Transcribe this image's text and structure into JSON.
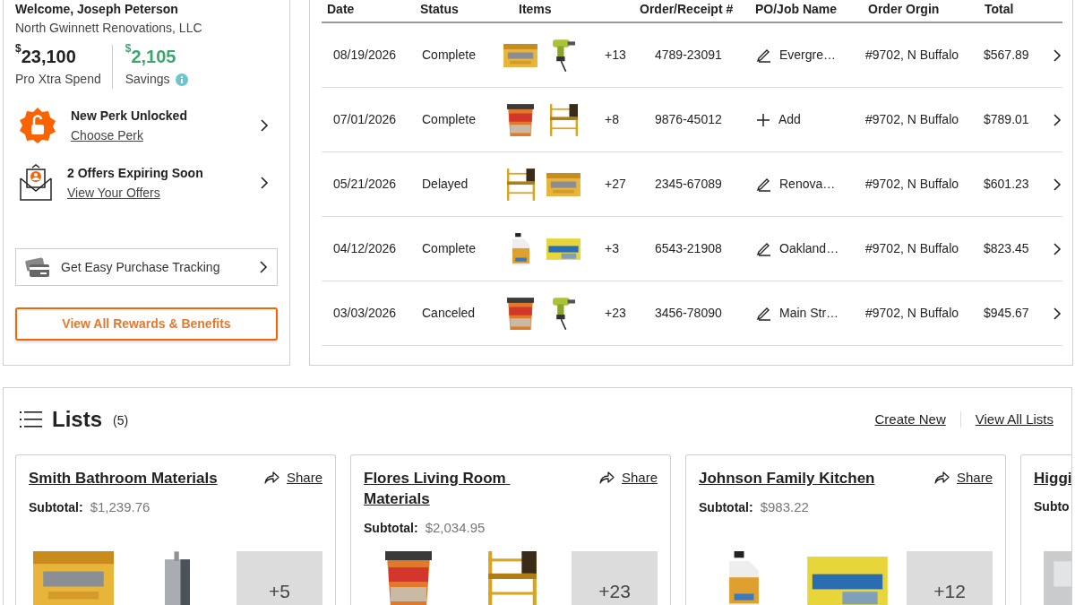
{
  "account": {
    "welcome": "Welcome, Joseph Peterson",
    "company": "North Gwinnett Renovations, LLC",
    "stats": [
      {
        "kind": "spend",
        "currency": "$",
        "amount": "23,100",
        "label": "Pro Xtra Spend"
      },
      {
        "kind": "savings",
        "currency": "$",
        "amount": "2,105",
        "label": "Savings"
      }
    ],
    "promos": [
      {
        "kind": "perk",
        "title": "New Perk Unlocked",
        "link": "Choose Perk"
      },
      {
        "kind": "offers",
        "title": "2 Offers Expiring Soon",
        "link": "View Your Offers"
      }
    ],
    "tracking_button": "Get Easy Purchase Tracking",
    "rewards_button": "View All Rewards & Benefits"
  },
  "orders": {
    "columns": [
      "Date",
      "Status",
      "Items",
      "Order/Receipt #",
      "PO/Job Name",
      "Order Orgin",
      "Total"
    ],
    "rows": [
      {
        "date": "08/19/2026",
        "status": "Complete",
        "more": "+13",
        "order": "4789-23091",
        "po": {
          "kind": "edit",
          "text": "Evergre…"
        },
        "origin": "#9702, N Buffalo",
        "total": "$567.89"
      },
      {
        "date": "07/01/2026",
        "status": "Complete",
        "more": "+8",
        "order": "9876-45012",
        "po": {
          "kind": "add",
          "text": "Add"
        },
        "origin": "#9702, N Buffalo",
        "total": "$789.01"
      },
      {
        "date": "05/21/2026",
        "status": "Delayed",
        "more": "+27",
        "order": "2345-67089",
        "po": {
          "kind": "edit",
          "text": "Renova…"
        },
        "origin": "#9702, N Buffalo",
        "total": "$601.23"
      },
      {
        "date": "04/12/2026",
        "status": "Complete",
        "more": "+3",
        "order": "6543-21908",
        "po": {
          "kind": "edit",
          "text": "Oakland…"
        },
        "origin": "#9702, N Buffalo",
        "total": "$823.45"
      },
      {
        "date": "03/03/2026",
        "status": "Canceled",
        "more": "+23",
        "order": "3456-78090",
        "po": {
          "kind": "edit",
          "text": "Main Str…"
        },
        "origin": "#9702, N Buffalo",
        "total": "$945.67"
      }
    ]
  },
  "lists": {
    "title": "Lists",
    "count": "(5)",
    "actions": [
      "Create New",
      "View All Lists"
    ],
    "cards": [
      {
        "title": "Smith Bathroom Materials",
        "share": "Share",
        "subtotal_label": "Subtotal:",
        "subtotal": "$1,239.76",
        "more": "+5"
      },
      {
        "title": "Flores Living Room Materials",
        "share": "Share",
        "subtotal_label": "Subtotal:",
        "subtotal": "$2,034.95",
        "more": "+23"
      },
      {
        "title": "Johnson Family Kitchen",
        "share": "Share",
        "subtotal_label": "Subtotal:",
        "subtotal": "$983.22",
        "more": "+12"
      },
      {
        "title": "Higgi",
        "subtotal_label": "Subto"
      }
    ]
  }
}
